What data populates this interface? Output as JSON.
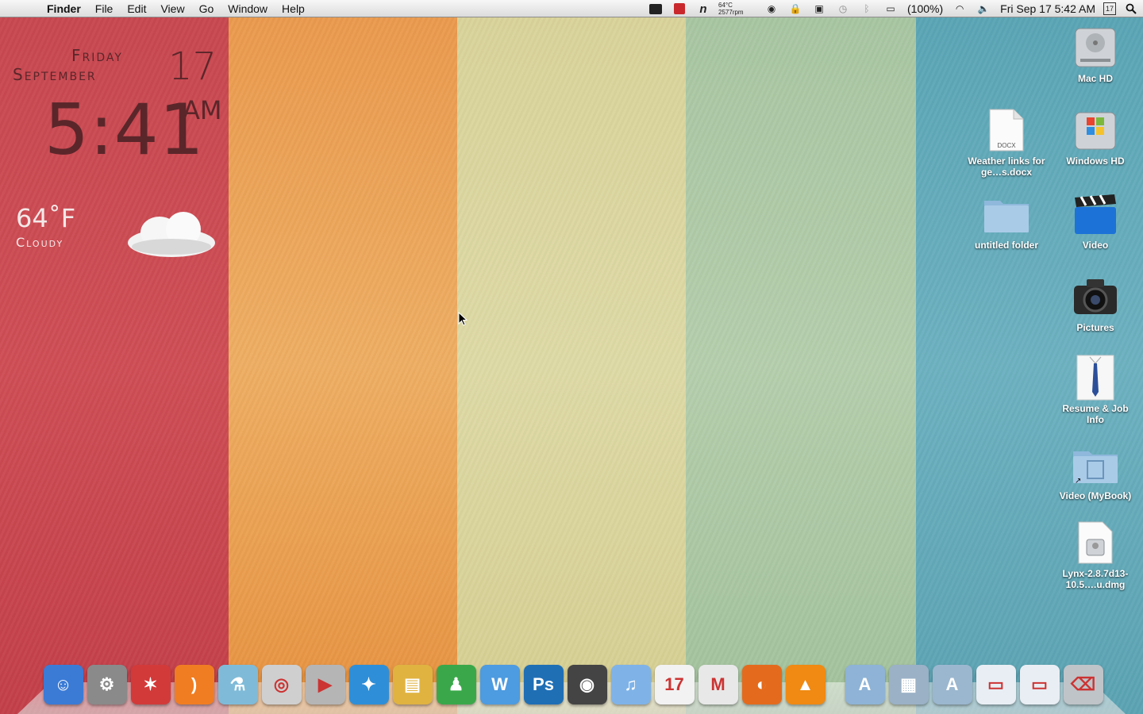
{
  "menubar": {
    "app": "Finder",
    "items": [
      "File",
      "Edit",
      "View",
      "Go",
      "Window",
      "Help"
    ],
    "temp_top": "64°C",
    "temp_bottom": "2577rpm",
    "battery": "(100%)",
    "clock": "Fri Sep 17  5:42 AM",
    "calendar_badge": "17"
  },
  "widget": {
    "day": "Friday",
    "month": "September",
    "date": "17",
    "time": "5:41",
    "ampm": "AM",
    "temperature": "64˚F",
    "condition": "Cloudy"
  },
  "desktop_icons": [
    {
      "label": "Mac HD",
      "icon": "hard-drive-icon"
    },
    {
      "label": "Weather links for ge…s.docx",
      "icon": "docx-icon",
      "badge": "DOCX"
    },
    {
      "label": "Windows HD",
      "icon": "windows-drive-icon"
    },
    {
      "label": "untitled folder",
      "icon": "folder-icon"
    },
    {
      "label": "Video",
      "icon": "clapperboard-icon"
    },
    {
      "label": "Pictures",
      "icon": "camera-icon"
    },
    {
      "label": "Resume & Job Info",
      "icon": "shirt-tie-icon"
    },
    {
      "label": "Video (MyBook)",
      "icon": "film-folder-icon"
    },
    {
      "label": "Lynx-2.8.7d13-10.5….u.dmg",
      "icon": "dmg-icon"
    }
  ],
  "dock": {
    "apps": [
      {
        "name": "finder",
        "color": "#3b7bd6",
        "glyph": "☺"
      },
      {
        "name": "system-preferences",
        "color": "#8a8a8a",
        "glyph": "⚙"
      },
      {
        "name": "raygun",
        "color": "#d23a3a",
        "glyph": "✶"
      },
      {
        "name": "rss-reader",
        "color": "#f07d22",
        "glyph": ")"
      },
      {
        "name": "flask",
        "color": "#7fbbd8",
        "glyph": "⚗"
      },
      {
        "name": "dvd-disc",
        "color": "#cfcfcf",
        "glyph": "◎"
      },
      {
        "name": "dvd-player",
        "color": "#b5b5b5",
        "glyph": "▶"
      },
      {
        "name": "twitter-bird",
        "color": "#2e8fd8",
        "glyph": "✦"
      },
      {
        "name": "transmit-truck",
        "color": "#e0b341",
        "glyph": "▤"
      },
      {
        "name": "adium",
        "color": "#3aa84a",
        "glyph": "♟"
      },
      {
        "name": "word",
        "color": "#4d9be0",
        "glyph": "W"
      },
      {
        "name": "photoshop",
        "color": "#1f6fb5",
        "glyph": "Ps"
      },
      {
        "name": "steam",
        "color": "#444444",
        "glyph": "◉"
      },
      {
        "name": "itunes",
        "color": "#7fb3e8",
        "glyph": "♫"
      },
      {
        "name": "ical",
        "color": "#f2f2f2",
        "glyph": "17"
      },
      {
        "name": "gmail",
        "color": "#e8e8e8",
        "glyph": "M"
      },
      {
        "name": "firefox",
        "color": "#e46b1d",
        "glyph": "◐"
      },
      {
        "name": "vlc",
        "color": "#f08a13",
        "glyph": "▲"
      }
    ],
    "stacks": [
      {
        "name": "applications-stack",
        "color": "#8eb3d6",
        "glyph": "A"
      },
      {
        "name": "documents-stack",
        "color": "#9ab1c6",
        "glyph": "▦"
      },
      {
        "name": "apps-folder-stack",
        "color": "#9bb7cf",
        "glyph": "A"
      },
      {
        "name": "window-preview",
        "color": "#e9eef4",
        "glyph": "▭"
      },
      {
        "name": "firefox-window",
        "color": "#e9eef4",
        "glyph": "▭"
      },
      {
        "name": "trash",
        "color": "#bfc4c8",
        "glyph": "⌫"
      }
    ]
  }
}
